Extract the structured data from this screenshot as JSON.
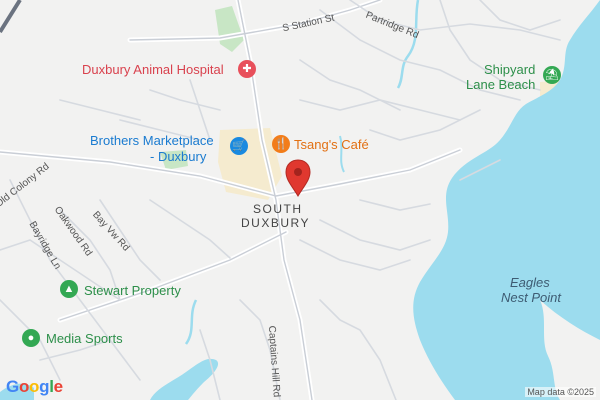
{
  "map": {
    "places": {
      "animal_hospital": "Duxbury Animal Hospital",
      "brothers_marketplace_line1": "Brothers Marketplace",
      "brothers_marketplace_line2": "- Duxbury",
      "tsangs_cafe": "Tsang's Café",
      "shipyard_line1": "Shipyard",
      "shipyard_line2": "Lane Beach",
      "stewart_property": "Stewart Property",
      "media_sports": "Media Sports"
    },
    "area_labels": {
      "south_line1": "SOUTH",
      "south_line2": "DUXBURY",
      "eagles_line1": "Eagles",
      "eagles_line2": "Nest Point"
    },
    "roads": {
      "s_station_st": "S Station St",
      "partridge_rd": "Partridge Rd",
      "old_colony_rd": "Old Colony Rd",
      "oakwood_rd": "Oakwood Rd",
      "bay_vw_rd": "Bay Vw Rd",
      "bayridge_ln": "Bayridge Ln",
      "captains_hill_rd": "Captains Hill Rd"
    },
    "attribution": "Map data ©2025",
    "logo_letters": [
      "G",
      "o",
      "o",
      "g",
      "l",
      "e"
    ],
    "colors": {
      "land": "#f2f2f1",
      "water": "#9cdcee",
      "road": "#c9ced6",
      "park": "#c8e6c5",
      "commercial": "#f5ebcf",
      "hospital": "#e8505b",
      "shop": "#1a8ae0",
      "restaurant": "#f27d1a",
      "park_poi": "#33a853",
      "pin": "#e0382f"
    }
  }
}
